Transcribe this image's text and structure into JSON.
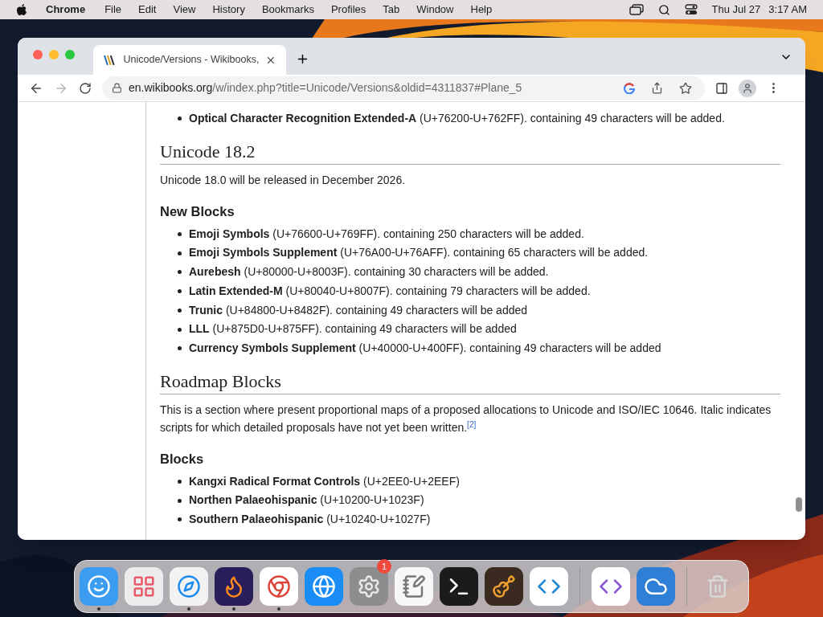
{
  "menu_bar": {
    "app": "Chrome",
    "items": [
      "File",
      "Edit",
      "View",
      "History",
      "Bookmarks",
      "Profiles",
      "Tab",
      "Window",
      "Help"
    ],
    "date": "Thu Jul 27",
    "time": "3:17 AM"
  },
  "browser": {
    "tabs": [
      {
        "title": "Unicode/Versions - Wikibooks,",
        "selected": true
      }
    ],
    "address": {
      "domain": "en.wikibooks.org",
      "path": "/w/index.php?title=Unicode/Versions&oldid=4311837#Plane_5"
    },
    "forward_disabled": true
  },
  "article": {
    "sections": [
      {
        "kind": "list",
        "items": [
          "**Optical Character Recognition Extended-A** (U+76200-U+762FF). containing 49 characters will be added."
        ]
      },
      {
        "kind": "heading",
        "text": "Unicode 18.2"
      },
      {
        "kind": "paragraph",
        "text": "Unicode 18.0 will be released in December 2026."
      },
      {
        "kind": "subheading",
        "text": "New Blocks"
      },
      {
        "kind": "list",
        "items": [
          "**Emoji Symbols** (U+76600-U+769FF). containing 250 characters will be added.",
          "**Emoji Symbols Supplement** (U+76A00-U+76AFF). containing 65 characters will be added.",
          "**Aurebesh** (U+80000-U+8003F). containing 30 characters will be added.",
          "**Latin Extended-M** (U+80040-U+8007F). containing 79 characters will be added.",
          "**Trunic** (U+84800-U+8482F). containing 49 characters will be added",
          "**LLL** (U+875D0-U+875FF). containing 49 characters will be added",
          "**Currency Symbols Supplement** (U+40000-U+400FF). containing 49 characters will be added"
        ]
      },
      {
        "kind": "heading",
        "text": "Roadmap Blocks"
      },
      {
        "kind": "paragraph",
        "text": "This is a section where present proportional maps of a proposed allocations to Unicode and ISO/IEC 10646. Italic indicates scripts for which detailed proposals have not yet been written.$^{[2]}$"
      },
      {
        "kind": "subheading",
        "text": "Blocks"
      },
      {
        "kind": "list",
        "items": [
          "**Kangxi Radical Format Controls** (U+2EE0-U+2EEF)",
          "**Northen Palaeohispanic** (U+10200-U+1023F)",
          "**Southern Palaeohispanic** (U+10240-U+1027F)"
        ]
      }
    ]
  },
  "dock": [
    {
      "running": true
    },
    {
      "running": false
    },
    {
      "running": true
    },
    {
      "running": true
    },
    {
      "running": true
    },
    {
      "running": false
    },
    {
      "running": false,
      "badge": "1"
    },
    {
      "running": false
    },
    {
      "running": false
    },
    {
      "running": false
    },
    {
      "running": false
    },
    {
      "running": false
    },
    {
      "running": false
    },
    {
      "running": false
    }
  ]
}
